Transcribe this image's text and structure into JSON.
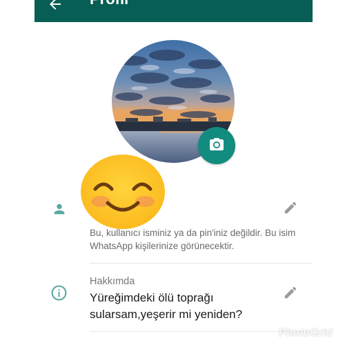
{
  "header": {
    "title": "Profil",
    "back_icon": "arrow-back-icon",
    "background": "#075e54"
  },
  "profile": {
    "photo": "sunset-over-water",
    "camera_icon": "camera-icon",
    "accent": "#128c7e"
  },
  "name_section": {
    "icon": "person-icon",
    "edit_icon": "pencil-icon",
    "hint": "Bu, kullanıcı isminiz ya da pin'iniz değildir. Bu isim WhatsApp kişilerinize görünecektir."
  },
  "about_section": {
    "icon": "info-icon",
    "edit_icon": "pencil-icon",
    "label": "Hakkımda",
    "value": "Yüreğimdeki ölü toprağı sularsam,yeşerir mi yeniden?"
  },
  "watermark": "PhotoGrid"
}
